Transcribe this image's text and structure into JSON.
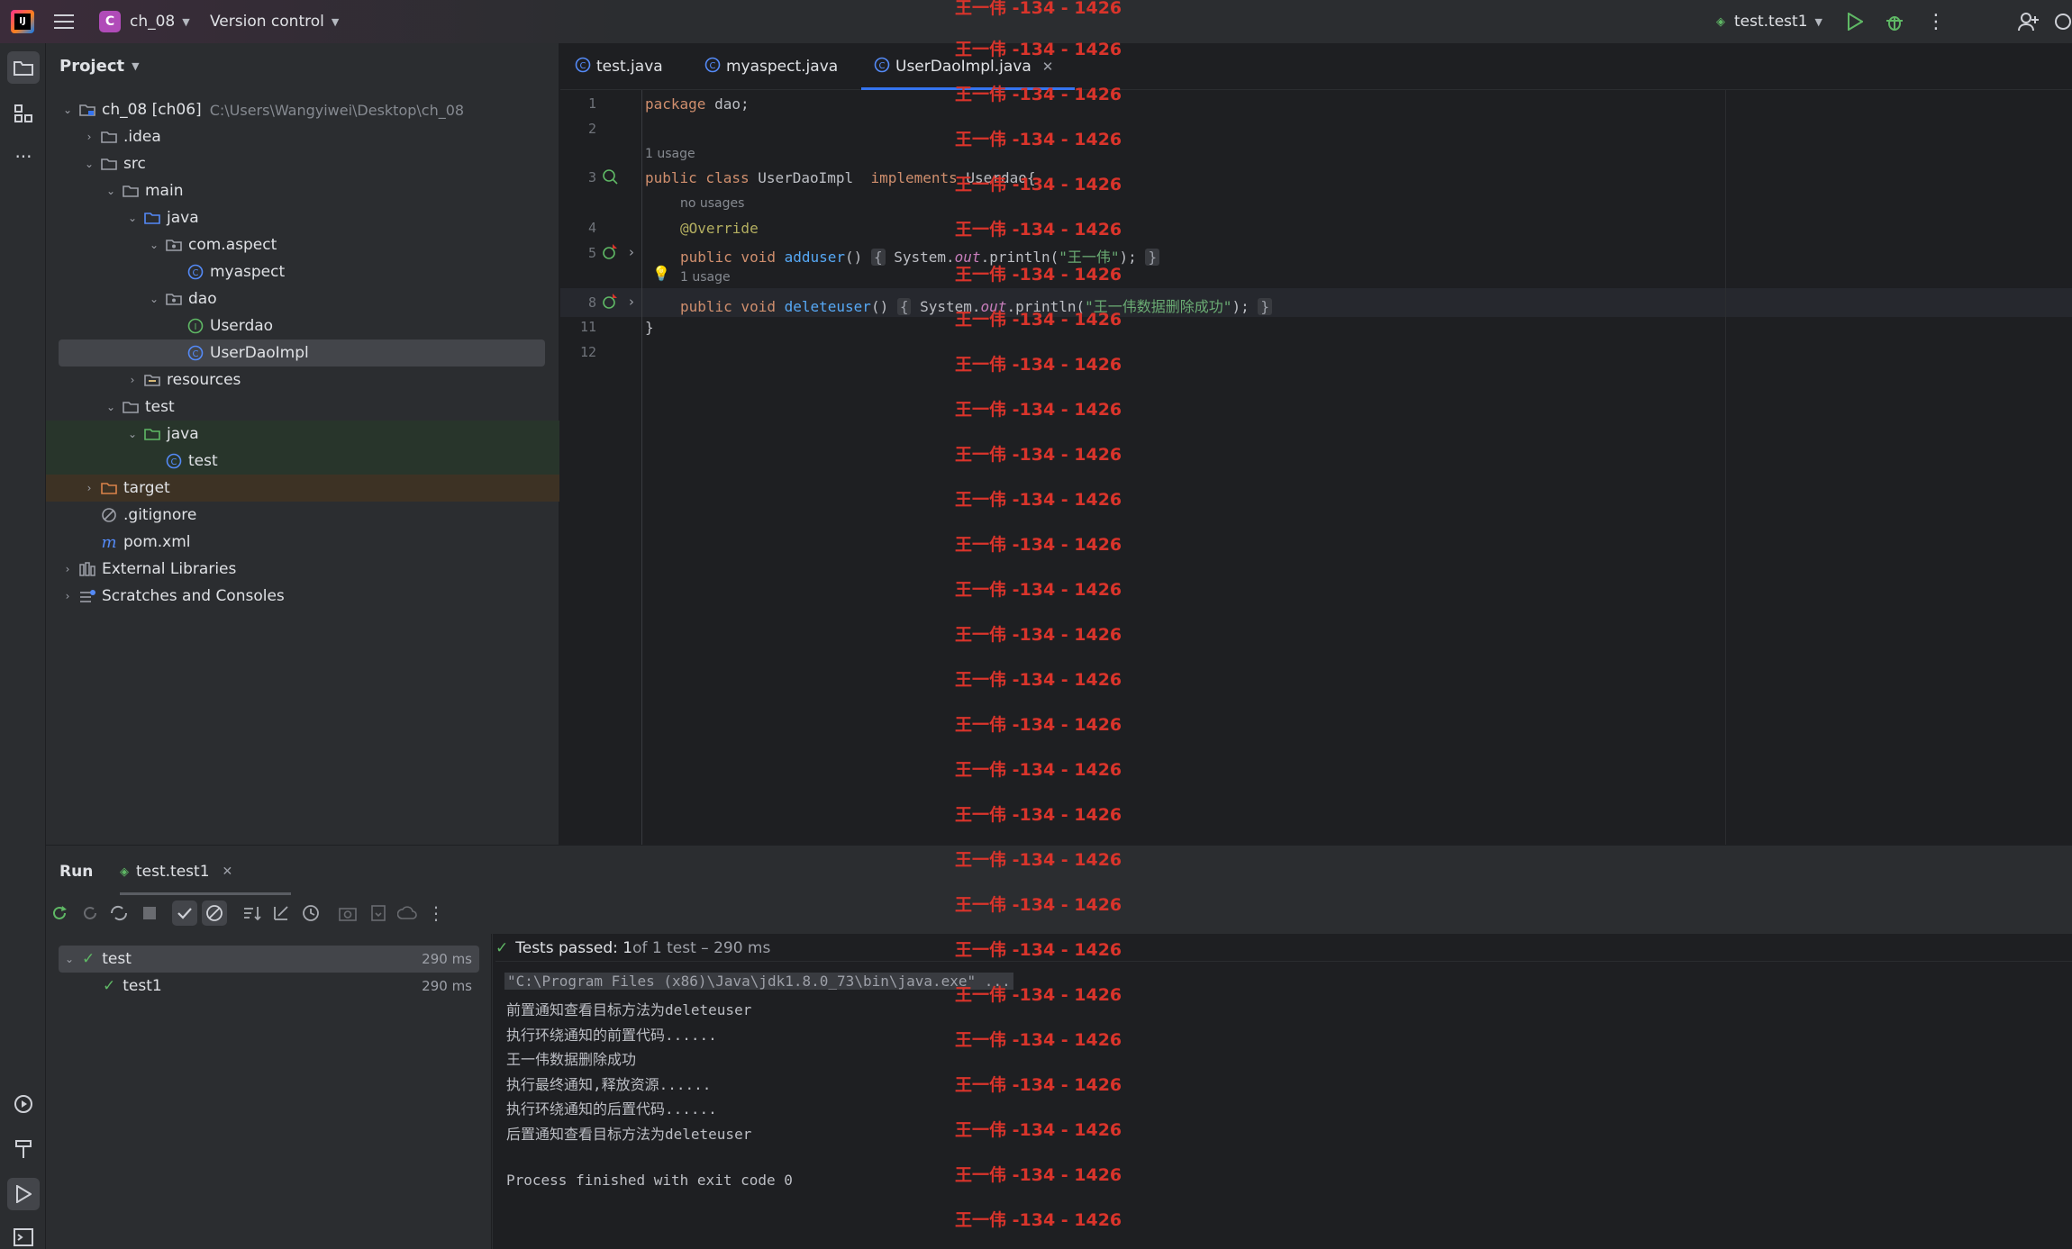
{
  "titlebar": {
    "logo_text": "IJ",
    "project_badge": "C",
    "project_name": "ch_08",
    "vcs": "Version control",
    "run_config": "test.test1"
  },
  "project_panel": {
    "title": "Project",
    "tree": [
      {
        "label": "ch_08 [ch06]",
        "hint": "C:\\Users\\Wangyiwei\\Desktop\\ch_08"
      },
      {
        "label": ".idea"
      },
      {
        "label": "src"
      },
      {
        "label": "main"
      },
      {
        "label": "java"
      },
      {
        "label": "com.aspect"
      },
      {
        "label": "myaspect"
      },
      {
        "label": "dao"
      },
      {
        "label": "Userdao"
      },
      {
        "label": "UserDaoImpl"
      },
      {
        "label": "resources"
      },
      {
        "label": "test"
      },
      {
        "label": "java"
      },
      {
        "label": "test"
      },
      {
        "label": "target"
      },
      {
        "label": ".gitignore"
      },
      {
        "label": "pom.xml"
      },
      {
        "label": "External Libraries"
      },
      {
        "label": "Scratches and Consoles"
      }
    ]
  },
  "editor": {
    "tabs": [
      "test.java",
      "myaspect.java",
      "UserDaoImpl.java"
    ],
    "active_tab": "UserDaoImpl.java",
    "line_numbers": [
      "1",
      "2",
      "3",
      "4",
      "5",
      "8",
      "11",
      "12"
    ],
    "inlays": {
      "usage1": "1 usage",
      "no_usages": "no usages",
      "usage2": "1 usage"
    },
    "code": {
      "l1_kw": "package",
      "l1_rest": " dao;",
      "l3_kw1": "public class",
      "l3_name": " UserDaoImpl  ",
      "l3_kw2": "implements",
      "l3_rest": " Userdao{",
      "l4_ann": "@Override",
      "l5_kw": "public void",
      "l5_fn": "adduser",
      "l5_paren": "() ",
      "l5_open": "{",
      "l5_sys": " System.",
      "l5_out": "out",
      "l5_print": ".println(",
      "l5_str": "\"王一伟\"",
      "l5_end": ");",
      "l5_close": "}",
      "l8_kw": "public void",
      "l8_fn": "deleteuser",
      "l8_paren": "() ",
      "l8_open": "{",
      "l8_sys": " System.",
      "l8_out": "out",
      "l8_print": ".println(",
      "l8_str": "\"王一伟数据删除成功\"",
      "l8_end": ");",
      "l8_close": "}",
      "l11": "}"
    }
  },
  "run_panel": {
    "title": "Run",
    "tab": "test.test1",
    "status_bold": "Tests passed: 1",
    "status_rest": " of 1 test – 290 ms",
    "tests": [
      {
        "name": "test",
        "duration": "290 ms"
      },
      {
        "name": "test1",
        "duration": "290 ms"
      }
    ],
    "console": [
      "\"C:\\Program Files (x86)\\Java\\jdk1.8.0_73\\bin\\java.exe\" ...",
      "前置通知查看目标方法为deleteuser",
      "执行环绕通知的前置代码......",
      "王一伟数据删除成功",
      "执行最终通知,释放资源......",
      "执行环绕通知的后置代码......",
      "后置通知查看目标方法为deleteuser",
      "",
      "Process finished with exit code 0"
    ]
  },
  "watermark": "王一伟 -134 - 1426",
  "colors": {
    "accent": "#3574f0",
    "watermark": "#d9342b",
    "pass": "#5fb865"
  }
}
